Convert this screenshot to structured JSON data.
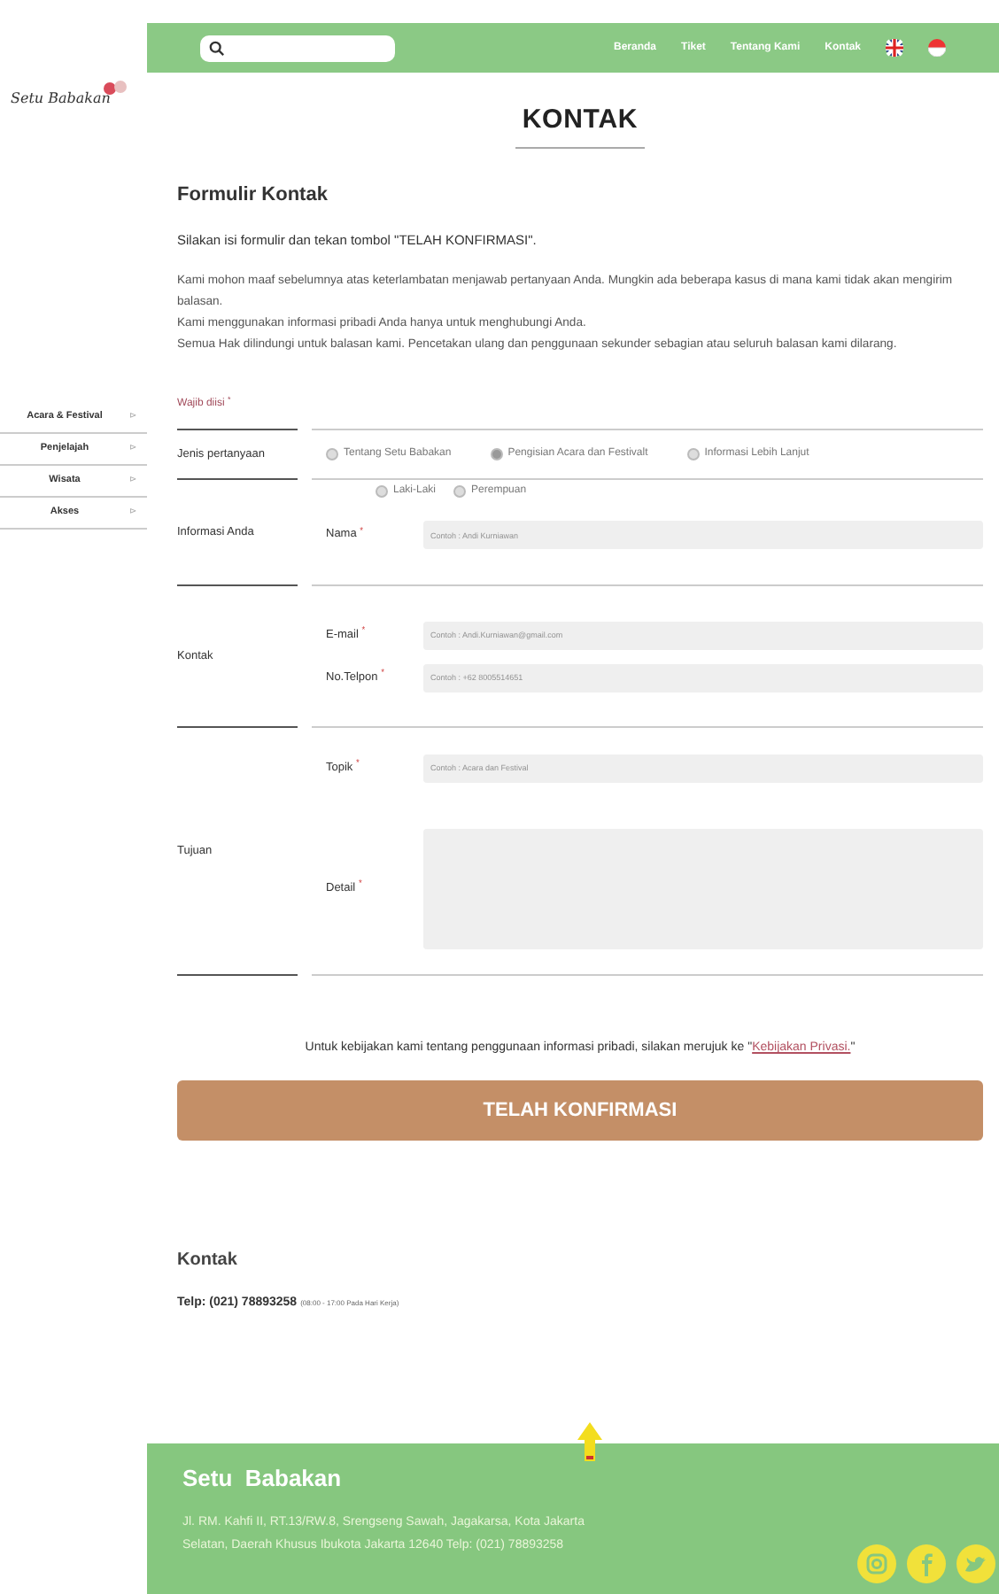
{
  "header": {
    "nav": [
      {
        "label": "Beranda"
      },
      {
        "label": "Tiket"
      },
      {
        "label": "Tentang Kami"
      },
      {
        "label": "Kontak"
      }
    ],
    "languages": [
      {
        "kind": "uk"
      },
      {
        "kind": "id"
      }
    ]
  },
  "logo": {
    "text": "Setu Babakan"
  },
  "sidebar": {
    "items": [
      {
        "label": "Acara & Festival",
        "arrow": "⊳"
      },
      {
        "label": "Penjelajah",
        "arrow": "⊳"
      },
      {
        "label": "Wisata",
        "arrow": "⊳"
      },
      {
        "label": "Akses",
        "arrow": "⊳"
      }
    ]
  },
  "page_title": "KONTAK",
  "form": {
    "title": "Formulir Kontak",
    "instruction": "Silakan isi formulir dan tekan tombol \"TELAH KONFIRMASI\".",
    "notes": [
      "Kami mohon maaf sebelumnya atas keterlambatan menjawab pertanyaan Anda. Mungkin ada beberapa kasus di mana kami tidak akan mengirim balasan.",
      "Kami menggunakan informasi pribadi Anda hanya untuk menghubungi Anda.",
      "Semua Hak dilindungi untuk balasan kami. Pencetakan ulang dan penggunaan sekunder sebagian atau seluruh balasan kami dilarang."
    ],
    "required_note": "Wajib diisi",
    "required_mark": "*",
    "sections": [
      {
        "label": "Jenis pertanyaan",
        "kind": "radios",
        "options": [
          {
            "label": "Tentang Setu Babakan",
            "selected": false
          },
          {
            "label": "Pengisian Acara dan Festivalt",
            "selected": true
          },
          {
            "label": "Informasi Lebih Lanjut",
            "selected": false
          }
        ]
      },
      {
        "label": "Informasi Anda",
        "kind": "fields",
        "radios": [
          {
            "label": "Laki-Laki",
            "selected": false
          },
          {
            "label": "Perempuan",
            "selected": false
          }
        ],
        "fields": [
          {
            "label": "Nama",
            "kind": "input",
            "placeholder": "Contoh : Andi Kurniawan"
          }
        ]
      },
      {
        "label": "Kontak",
        "kind": "fields",
        "fields": [
          {
            "label": "E-mail",
            "kind": "input",
            "placeholder": "Contoh : Andi.Kurniawan@gmail.com"
          },
          {
            "label": "No.Telpon",
            "kind": "input",
            "placeholder": "Contoh : +62 8005514651"
          }
        ]
      },
      {
        "label": "Tujuan",
        "kind": "fields",
        "fields": [
          {
            "label": "Topik",
            "kind": "input",
            "placeholder": "Contoh : Acara dan Festival"
          },
          {
            "label": "Detail",
            "kind": "textarea"
          }
        ]
      }
    ],
    "privacy_text": "Untuk kebijakan kami tentang penggunaan informasi pribadi, silakan merujuk ke \"",
    "privacy_link": "Kebijakan Privasi.",
    "privacy_end": "\"",
    "submit": "TELAH KONFIRMASI"
  },
  "contact": {
    "title": "Kontak",
    "phone": "Telp: (021) 78893258",
    "hours": "(08:00 - 17:00 Pada Hari Kerja)"
  },
  "footer": {
    "title": "Setu  Babakan",
    "address": "Jl. RM. Kahfi II, RT.13/RW.8, Srengseng Sawah, Jagakarsa, Kota Jakarta Selatan, Daerah Khusus Ibukota Jakarta 12640 Telp: (021) 78893258",
    "social": [
      {
        "kind": "instagram"
      },
      {
        "kind": "facebook"
      },
      {
        "kind": "twitter"
      }
    ]
  }
}
